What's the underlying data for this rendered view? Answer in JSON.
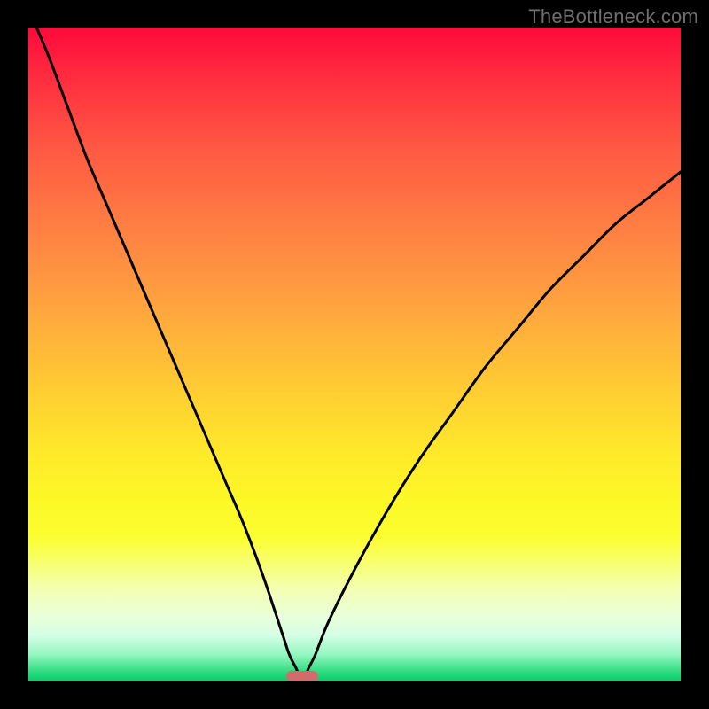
{
  "watermark": "TheBottleneck.com",
  "colors": {
    "frame": "#000000",
    "curve": "#000000",
    "marker": "#d56a6a"
  },
  "chart_data": {
    "type": "line",
    "title": "",
    "xlabel": "",
    "ylabel": "",
    "xlim": [
      0,
      100
    ],
    "ylim": [
      0,
      100
    ],
    "grid": false,
    "notes": "Bottleneck-style V curve. Y represents mismatch percentage (0 at optimum, ~100 at extremes). Minimum around x≈42. Horizontal red marker at the curve minimum.",
    "series": [
      {
        "name": "bottleneck-curve",
        "x": [
          0,
          3,
          6,
          9,
          12,
          15,
          18,
          21,
          24,
          27,
          30,
          33,
          36,
          39,
          40,
          41,
          42,
          43,
          44,
          46,
          50,
          55,
          60,
          65,
          70,
          75,
          80,
          85,
          90,
          95,
          100
        ],
        "values": [
          103,
          96,
          88,
          80,
          73,
          66,
          59,
          52,
          45,
          38,
          31,
          24,
          16,
          7,
          4,
          2,
          0,
          2,
          4,
          9,
          17,
          26,
          34,
          41,
          48,
          54,
          60,
          65,
          70,
          74,
          78
        ]
      }
    ],
    "marker": {
      "x": 42,
      "y": 0,
      "shape": "rounded-bar"
    }
  }
}
